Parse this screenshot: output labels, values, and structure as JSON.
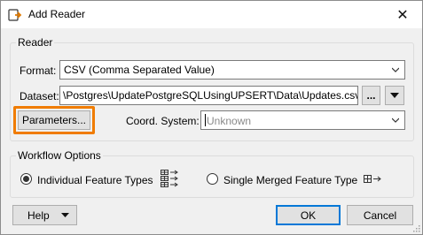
{
  "window": {
    "title": "Add Reader",
    "close_symbol": "✕"
  },
  "reader": {
    "legend": "Reader",
    "format_label": "Format:",
    "format_value": "CSV (Comma Separated Value)",
    "dataset_label": "Dataset:",
    "dataset_value": "\\Postgres\\UpdatePostgreSQLUsingUPSERT\\Data\\Updates.csv\"",
    "browse_label": "...",
    "parameters_label": "Parameters...",
    "coord_label": "Coord. System:",
    "coord_value": "Unknown"
  },
  "workflow": {
    "legend": "Workflow Options",
    "option1": "Individual Feature Types",
    "option2": "Single Merged Feature Type",
    "selected": "option1"
  },
  "footer": {
    "help_label": "Help",
    "ok_label": "OK",
    "cancel_label": "Cancel"
  },
  "colors": {
    "highlight": "#f07c00",
    "default_button": "#0078d7"
  },
  "icons": [
    "reader-add-icon",
    "close-icon",
    "chevron-down-icon",
    "dropdown-arrow-icon",
    "individual-features-icon",
    "merged-feature-icon",
    "resize-grip-icon"
  ]
}
